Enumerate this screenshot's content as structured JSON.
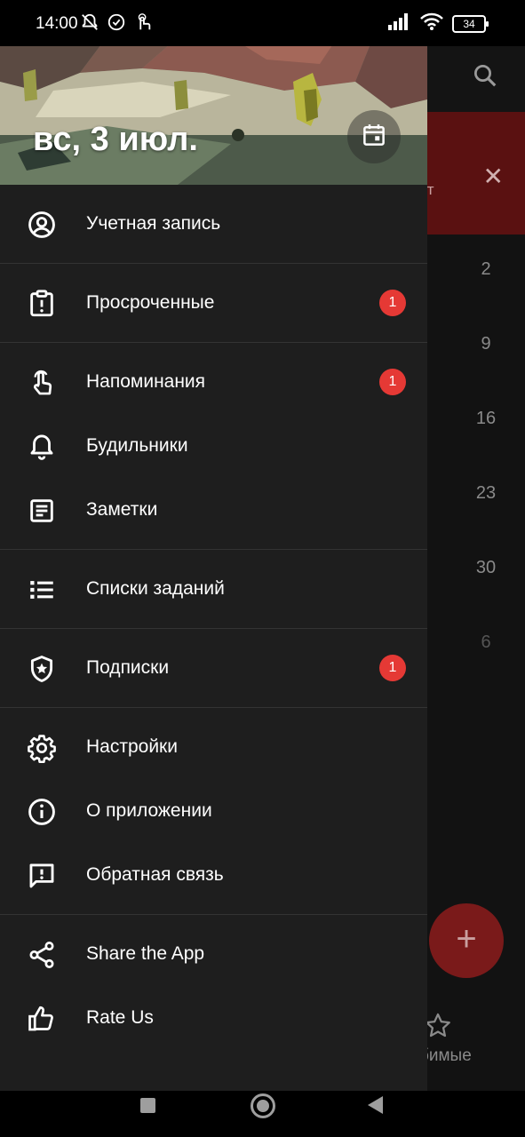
{
  "status_bar": {
    "time": "14:00",
    "battery": "34",
    "icons": [
      "mute-notifications-icon",
      "check-circle-icon",
      "touch-icon",
      "signal-icon",
      "wifi-icon",
      "battery-icon"
    ]
  },
  "background_app": {
    "banner_text_fragment": "дет",
    "days": [
      "2",
      "9",
      "16",
      "23",
      "30",
      "6"
    ],
    "fab_label": "+",
    "favorites_fragment": "бимые",
    "colors": {
      "banner": "#5a1111",
      "fab": "#7a1a1a"
    }
  },
  "drawer": {
    "header": {
      "date": "вс, 3 июл."
    },
    "items": [
      {
        "label": "Учетная запись",
        "icon": "account-circle-icon"
      },
      {
        "label": "Просроченные",
        "icon": "clipboard-alert-icon",
        "badge": "1"
      },
      {
        "label": "Напоминания",
        "icon": "touch-icon",
        "badge": "1"
      },
      {
        "label": "Будильники",
        "icon": "bell-icon"
      },
      {
        "label": "Заметки",
        "icon": "note-icon"
      },
      {
        "label": "Списки заданий",
        "icon": "list-icon"
      },
      {
        "label": "Подписки",
        "icon": "shield-star-icon",
        "badge": "1"
      },
      {
        "label": "Настройки",
        "icon": "gear-icon"
      },
      {
        "label": "О приложении",
        "icon": "info-icon"
      },
      {
        "label": "Обратная связь",
        "icon": "feedback-icon"
      },
      {
        "label": "Share the App",
        "icon": "share-icon"
      },
      {
        "label": "Rate Us",
        "icon": "thumb-up-icon"
      }
    ],
    "colors": {
      "badge": "#e53935",
      "background": "#1e1e1e"
    }
  }
}
